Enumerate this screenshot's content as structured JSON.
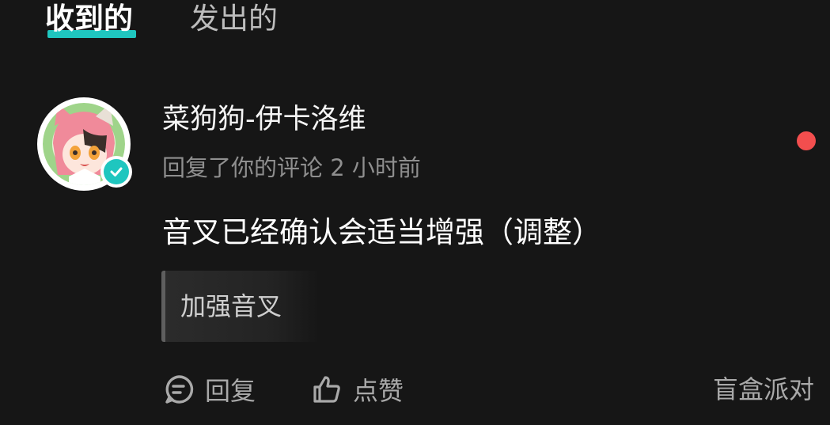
{
  "tabs": {
    "received": "收到的",
    "sent": "发出的"
  },
  "notification": {
    "username": "菜狗狗-伊卡洛维",
    "action_text": "回复了你的评论",
    "time": "2 小时前",
    "comment": "音叉已经确认会适当增强（调整）",
    "quoted": "加强音叉",
    "reply_label": "回复",
    "like_label": "点赞",
    "source": "盲盒派对",
    "unread": true
  },
  "colors": {
    "accent": "#1fc6bf",
    "unread_dot": "#f24e4e",
    "background": "#161616"
  },
  "icons": {
    "avatar": "anime-girl-avatar",
    "verified": "verified-check-icon",
    "reply": "chat-bubble-icon",
    "like": "thumbs-up-icon"
  }
}
